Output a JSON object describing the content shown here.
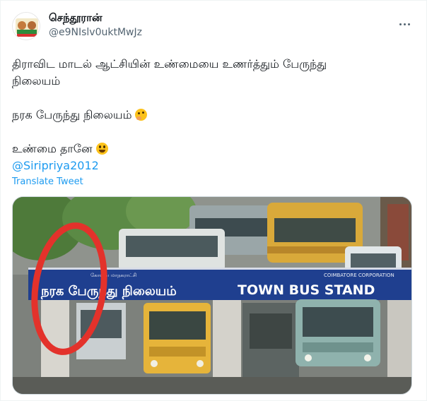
{
  "tweet": {
    "display_name": "செந்தூரான்",
    "handle": "@e9NIslv0uktMwJz",
    "line1": "திராவிட மாடல் ஆட்சியின் உண்மையை உணர்த்தும் பேருந்து",
    "line2": "நிலையம்",
    "line3": "நரக பேருந்து நிலையம்",
    "line4": "உண்மை தானே",
    "mention": "@Siripriya2012",
    "translate_label": "Translate Tweet",
    "more_icon": "more-horizontal-icon"
  },
  "photo": {
    "sign_left_small": "கோவை மாநகராட்சி",
    "sign_right_small": "COIMBATORE CORPORATION",
    "sign_tamil": "நரக பேருந்து நிலையம்",
    "sign_english": "TOWN BUS STAND",
    "colors": {
      "sign_blue": "#1f3f8f",
      "circle_red": "#e3322b",
      "bus_yellow": "#e6b43a"
    }
  }
}
